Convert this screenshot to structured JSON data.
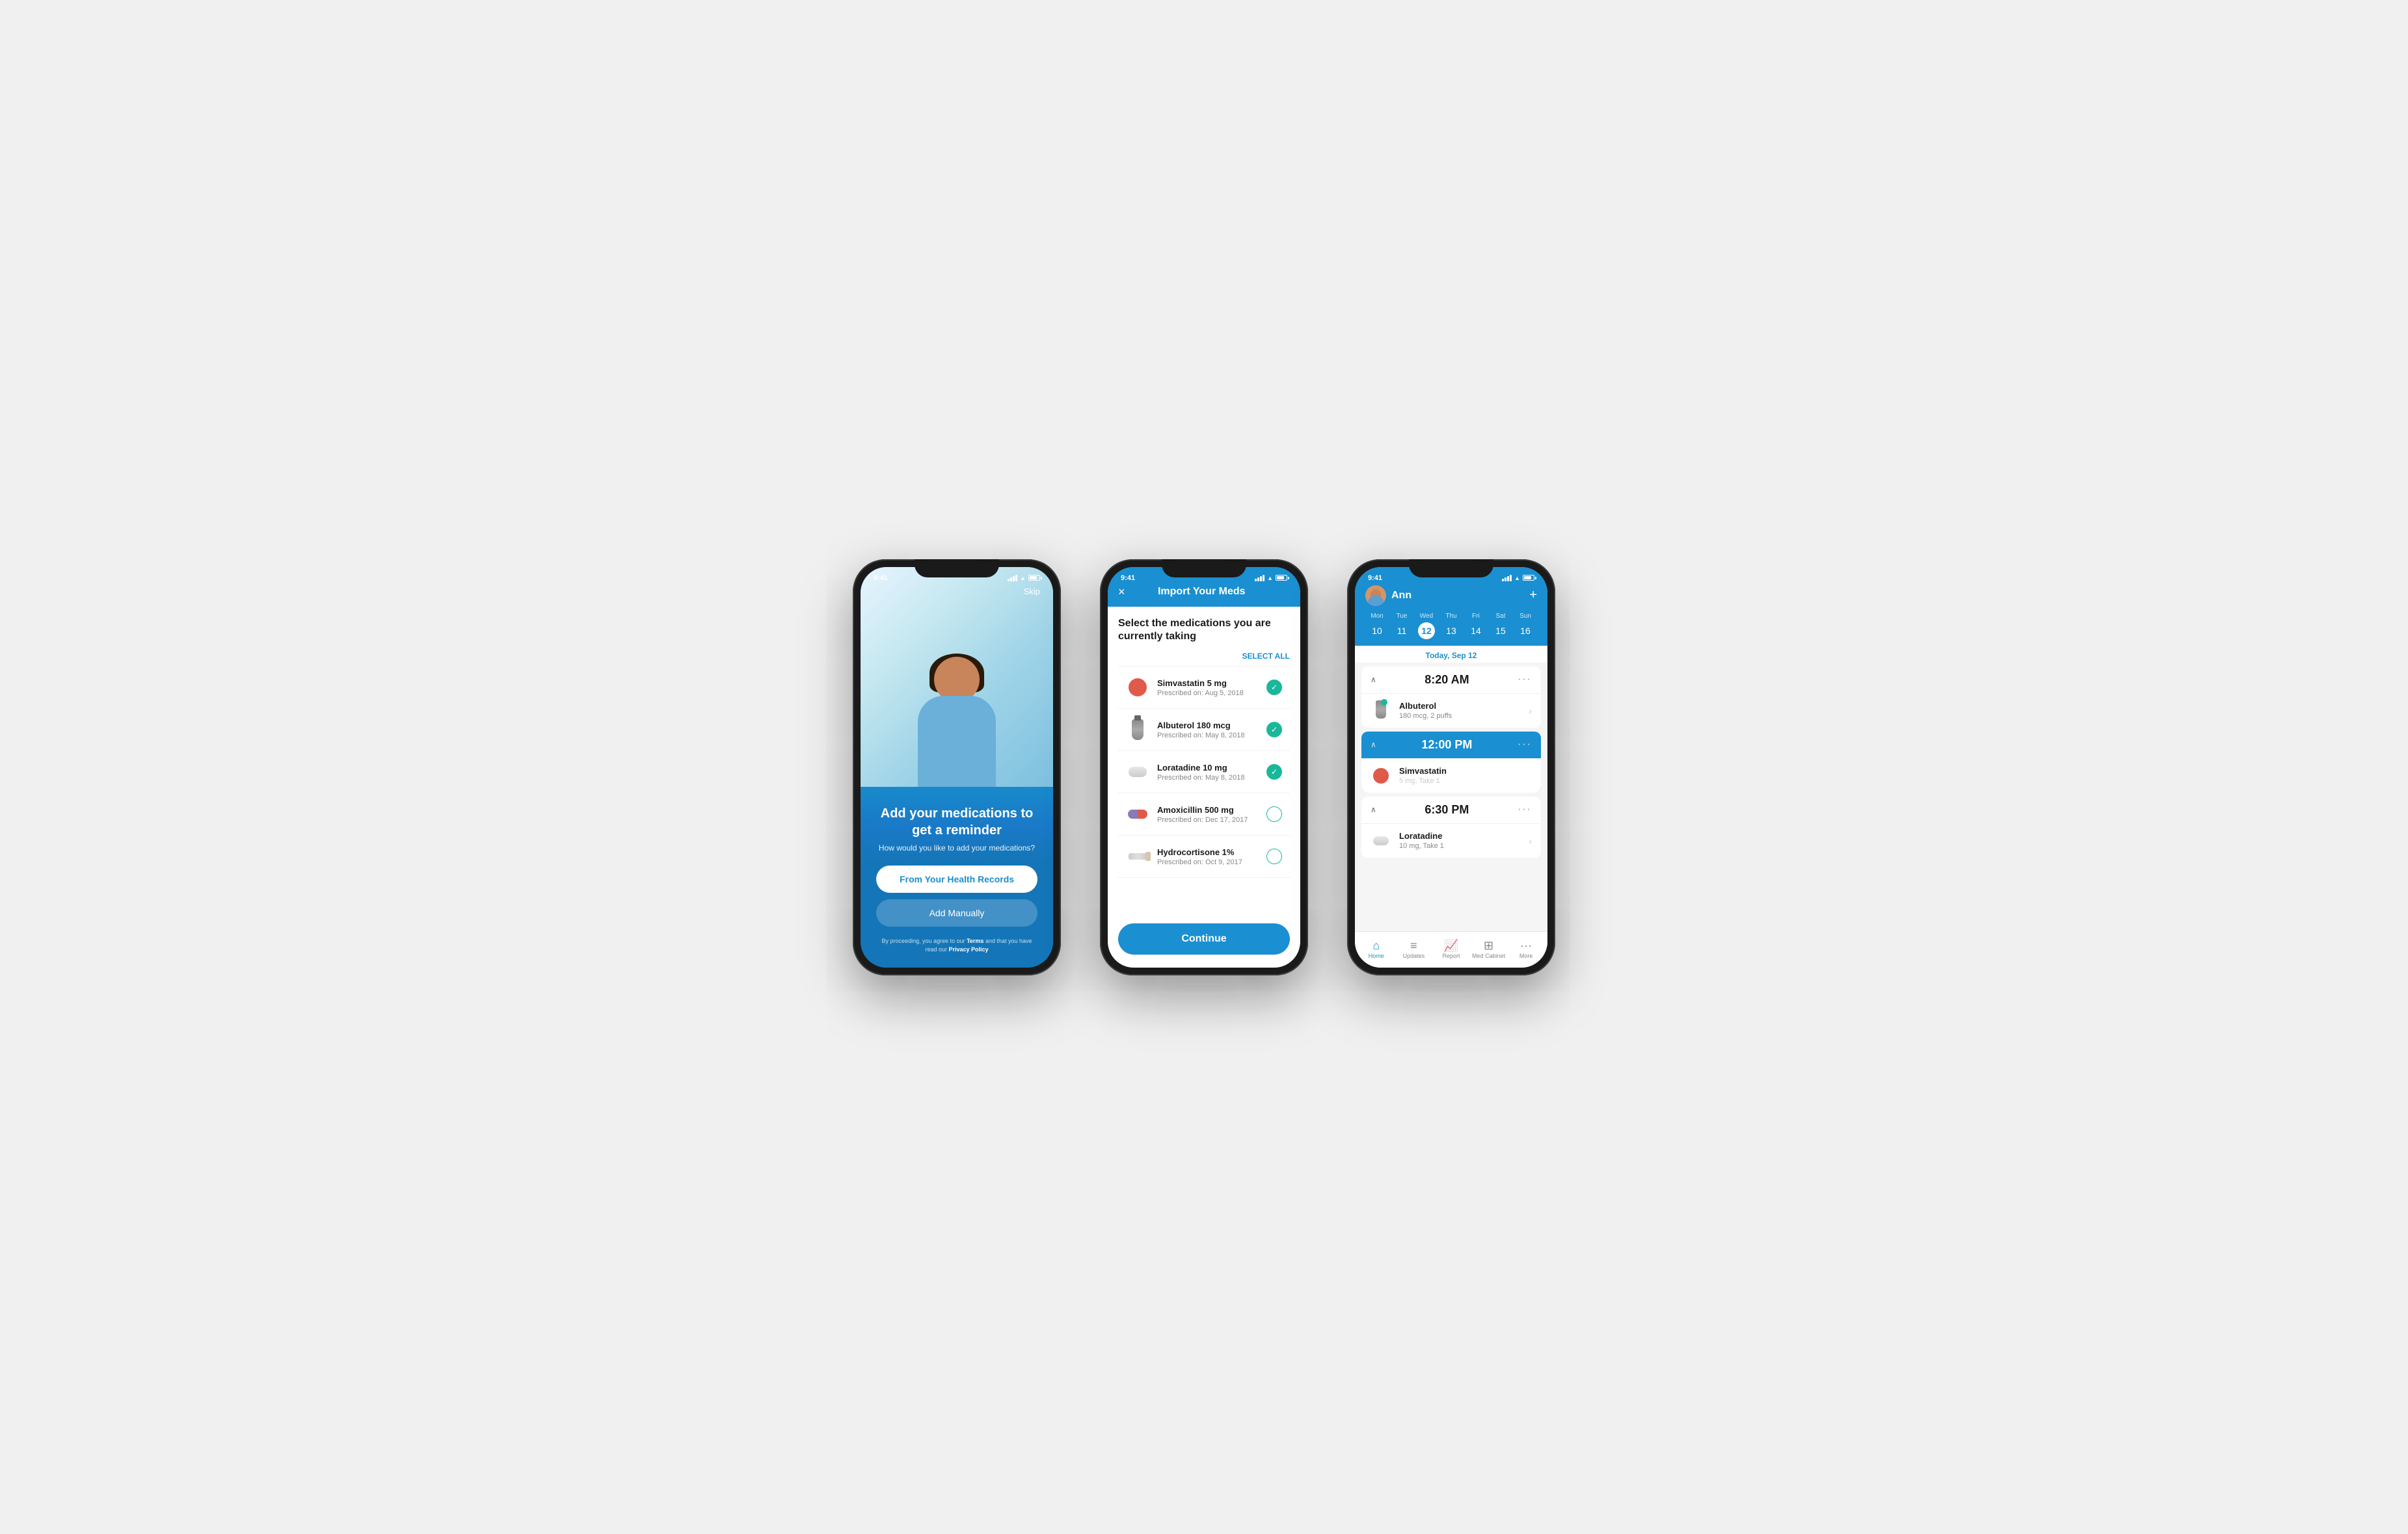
{
  "phone1": {
    "status_time": "9:41",
    "skip_label": "Skip",
    "title": "Add your medications to get a reminder",
    "subtitle": "How would you like to add your medications?",
    "btn_primary": "From Your Health Records",
    "btn_secondary": "Add Manually",
    "footer_text_1": "By proceeding, you agree to our ",
    "footer_terms": "Terms",
    "footer_text_2": " and that you have read our ",
    "footer_privacy": "Privacy Policy"
  },
  "phone2": {
    "status_time": "9:41",
    "header_title": "Import Your Meds",
    "close_label": "×",
    "instruction": "Select the medications you are currently taking",
    "select_all": "SELECT ALL",
    "medications": [
      {
        "name": "Simvastatin 5 mg",
        "prescribed": "Prescribed on: Aug 5, 2018",
        "selected": true,
        "pill_type": "red"
      },
      {
        "name": "Albuterol 180 mcg",
        "prescribed": "Prescribed on: May 8, 2018",
        "selected": true,
        "pill_type": "inhaler"
      },
      {
        "name": "Loratadine 10 mg",
        "prescribed": "Prescribed on: May 8, 2018",
        "selected": true,
        "pill_type": "oval"
      },
      {
        "name": "Amoxicillin 500 mg",
        "prescribed": "Prescribed on: Dec 17, 2017",
        "selected": false,
        "pill_type": "capsule"
      },
      {
        "name": "Hydrocortisone 1%",
        "prescribed": "Prescribed on: Oct 9, 2017",
        "selected": false,
        "pill_type": "tube"
      }
    ],
    "continue_label": "Continue"
  },
  "phone3": {
    "status_time": "9:41",
    "user_name": "Ann",
    "plus_label": "+",
    "calendar": {
      "days": [
        "Mon",
        "Tue",
        "Wed",
        "Thu",
        "Fri",
        "Sat",
        "Sun"
      ],
      "dates": [
        "10",
        "11",
        "12",
        "13",
        "14",
        "15",
        "16"
      ],
      "today_index": 2
    },
    "today_label": "Today, Sep 12",
    "time_slots": [
      {
        "time": "8:20 AM",
        "active": false,
        "meds": [
          {
            "name": "Albuterol",
            "dose": "180 mcg, 2 puffs",
            "pill_type": "inhaler",
            "checked": true
          }
        ]
      },
      {
        "time": "12:00 PM",
        "active": true,
        "meds": [
          {
            "name": "Simvastatin",
            "dose": "5 mg, Take 1",
            "pill_type": "red",
            "checked": false
          }
        ]
      },
      {
        "time": "6:30 PM",
        "active": false,
        "meds": [
          {
            "name": "Loratadine",
            "dose": "10 mg, Take 1",
            "pill_type": "oval",
            "checked": false
          }
        ]
      }
    ],
    "nav": [
      {
        "icon": "🏠",
        "label": "Home",
        "active": true
      },
      {
        "icon": "📋",
        "label": "Updates",
        "active": false
      },
      {
        "icon": "📈",
        "label": "Report",
        "active": false
      },
      {
        "icon": "💊",
        "label": "Med Cabinet",
        "active": false
      },
      {
        "icon": "•••",
        "label": "More",
        "active": false
      }
    ]
  }
}
